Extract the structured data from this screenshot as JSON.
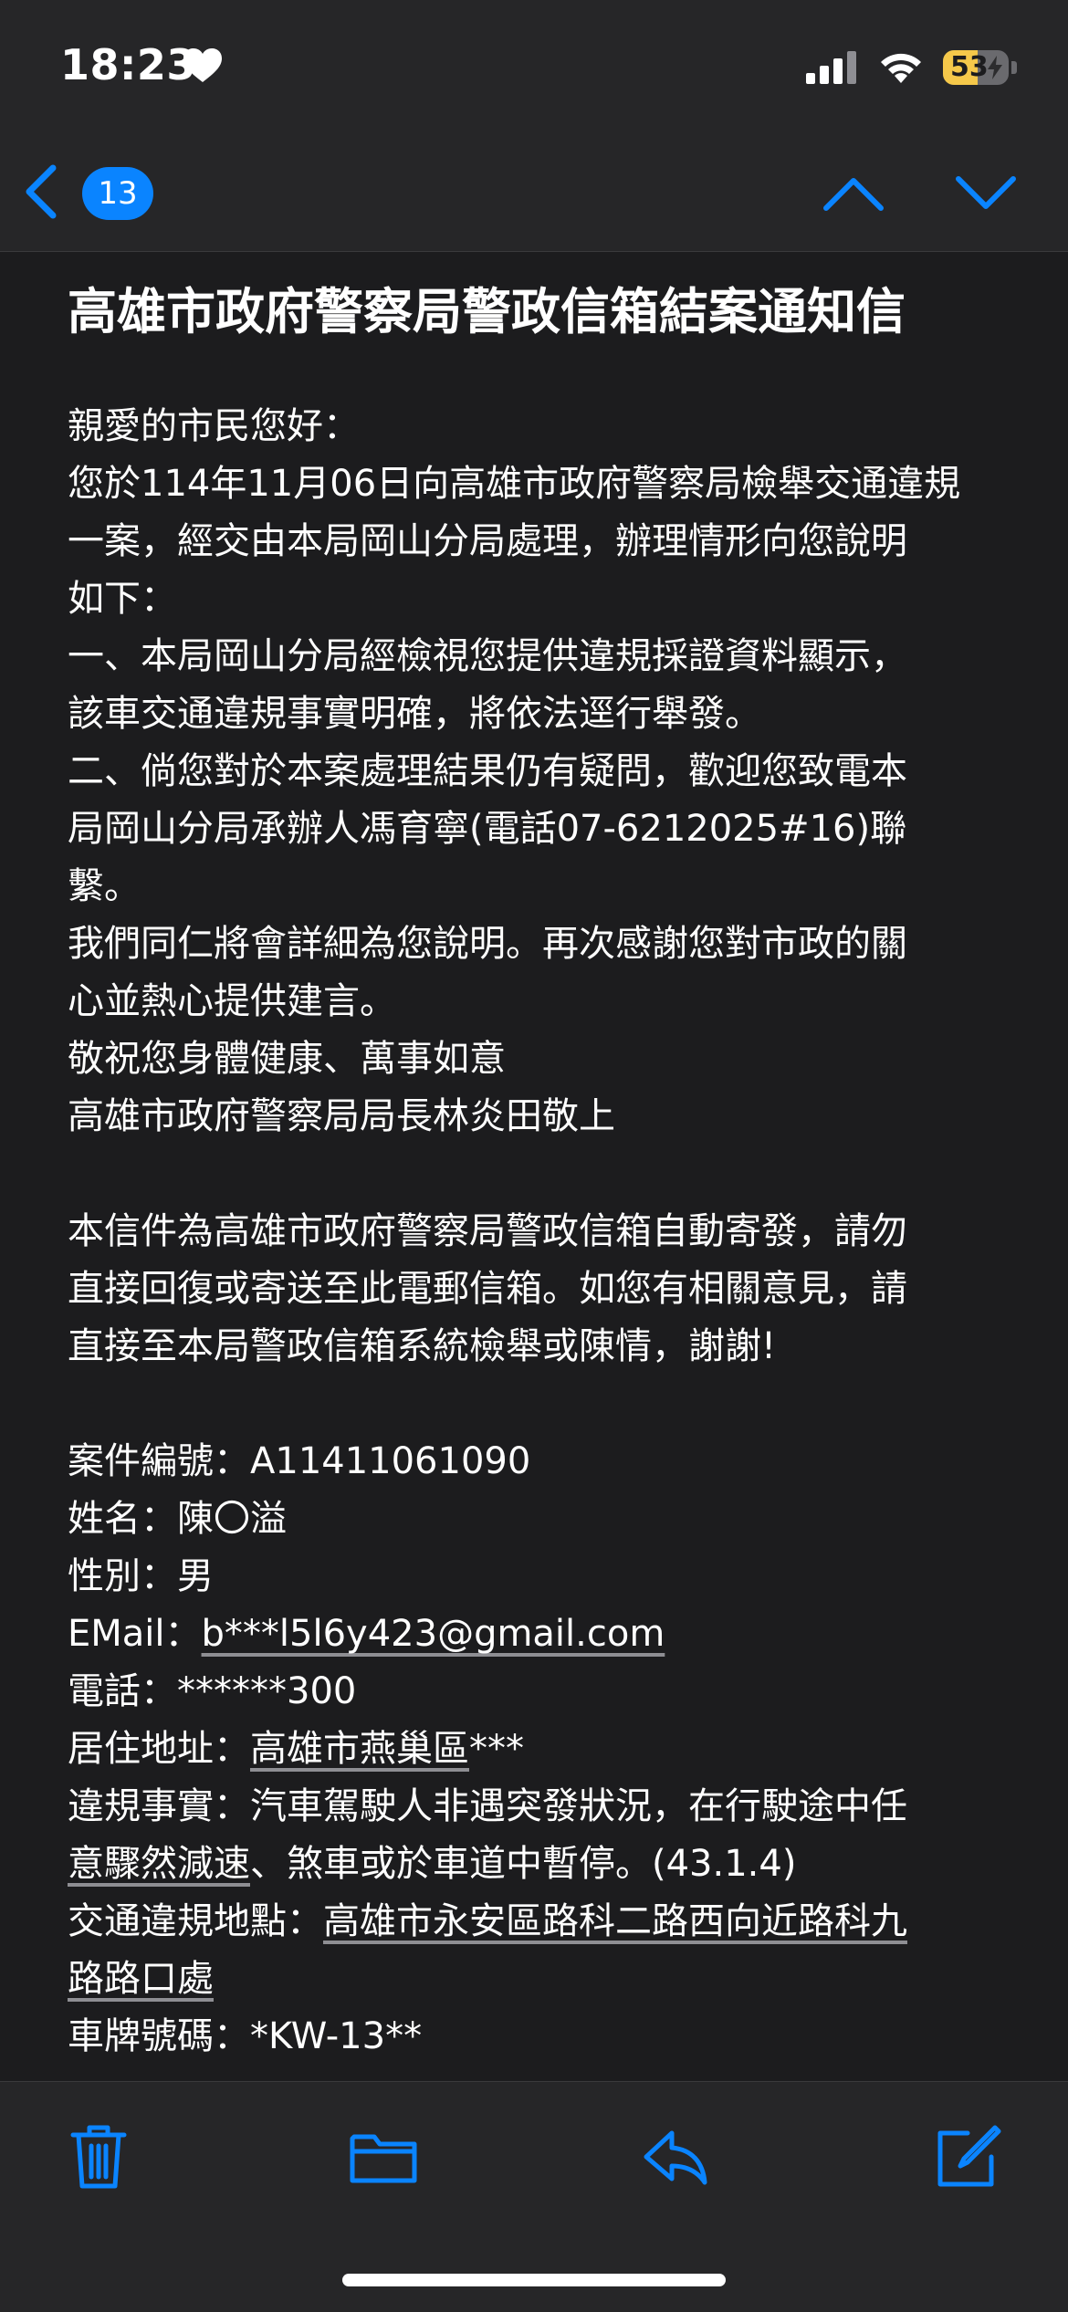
{
  "status_bar": {
    "time": "18:23",
    "battery_level": "53",
    "icons": [
      "heart-icon",
      "cellular-signal-icon",
      "wifi-icon",
      "battery-icon"
    ]
  },
  "nav": {
    "unread_count": "13",
    "icons": [
      "chevron-left-icon",
      "chevron-up-icon",
      "chevron-down-icon"
    ]
  },
  "email": {
    "subject": "高雄市政府警察局警政信箱結案通知信",
    "body_lines": [
      "親愛的市民您好：",
      "您於114年11月06日向高雄市政府警察局檢舉交通違規",
      "一案，經交由本局岡山分局處理，辦理情形向您說明",
      "如下：",
      "一、本局岡山分局經檢視您提供違規採證資料顯示，",
      "該車交通違規事實明確，將依法逕行舉發。",
      "二、倘您對於本案處理結果仍有疑問，歡迎您致電本",
      "局岡山分局承辦人馮育寧(電話07-6212025#16)聯",
      "繫。",
      "我們同仁將會詳細為您說明。再次感謝您對市政的關",
      "心並熱心提供建言。",
      "敬祝您身體健康、萬事如意",
      "高雄市政府警察局局長林炎田敬上"
    ],
    "notice_lines": [
      "本信件為高雄市政府警察局警政信箱自動寄發，請勿",
      "直接回復或寄送至此電郵信箱。如您有相關意見，請",
      "直接至本局警政信箱系統檢舉或陳情，謝謝!"
    ],
    "details": {
      "case_no_label": "案件編號：",
      "case_no": "A11411061090",
      "name_label": "姓名：",
      "name": "陳〇溢",
      "gender_label": "性別：",
      "gender": "男",
      "email_label": "EMail：",
      "email": "b***l5l6y423@gmail.com",
      "phone_label": "電話：",
      "phone": "******300",
      "address_label": "居住地址：",
      "address_link": "高雄市燕巢區",
      "address_rest": "***",
      "violation_label": "違規事實：",
      "violation_line1": "汽車駕駛人非遇突發狀況，在行駛途中任",
      "violation_line2_link": "意驟然減速",
      "violation_line2_rest": "、煞車或於車道中暫停。(43.1.4)",
      "location_label": "交通違規地點：",
      "location_line1": "高雄市永安區路科二路西向近路科九",
      "location_line2": "路路口處",
      "plate_label": "車牌號碼：",
      "plate": "*KW-13**"
    }
  },
  "toolbar": {
    "icons": [
      "trash-icon",
      "folder-icon",
      "reply-icon",
      "compose-icon"
    ]
  },
  "colors": {
    "accent": "#0a84ff",
    "background": "#1c1c1e",
    "bar_background": "#262628",
    "battery_yellow": "#f5c84a"
  }
}
